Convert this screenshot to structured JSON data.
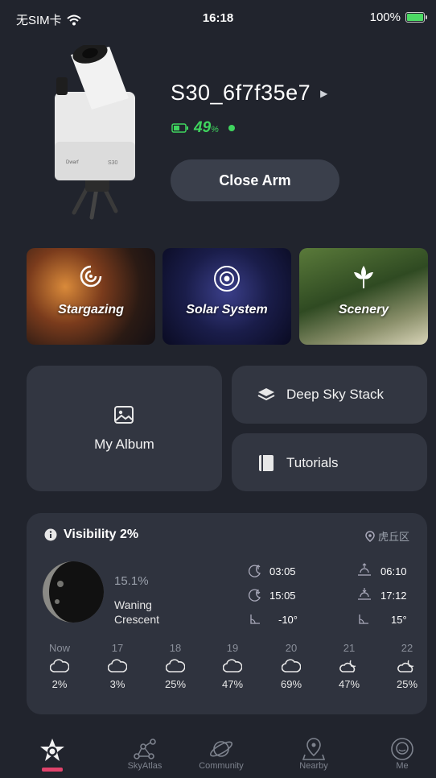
{
  "status_bar": {
    "carrier": "无SIM卡",
    "time": "16:18",
    "battery": "100%"
  },
  "device": {
    "name": "S30_6f7f35e7",
    "battery_value": "49",
    "battery_unit": "%",
    "brand": "Dwarf",
    "model": "S30",
    "connected": true
  },
  "close_arm_label": "Close Arm",
  "modes": [
    {
      "label": "Stargazing"
    },
    {
      "label": "Solar System"
    },
    {
      "label": "Scenery"
    }
  ],
  "tiles": {
    "album": "My Album",
    "stack": "Deep Sky Stack",
    "tutorials": "Tutorials"
  },
  "visibility": {
    "title": "Visibility 2%",
    "location": "虎丘区",
    "moon_percent": "15.1%",
    "moon_phase_1": "Waning",
    "moon_phase_2": "Crescent",
    "moonrise": "03:05",
    "moonset": "15:05",
    "moon_alt": "-10°",
    "sunrise": "06:10",
    "sunset": "17:12",
    "sun_alt": "15°",
    "forecast": [
      {
        "hour": "Now",
        "pct": "2%",
        "icon": "cloud-icon"
      },
      {
        "hour": "17",
        "pct": "3%",
        "icon": "cloud-icon"
      },
      {
        "hour": "18",
        "pct": "25%",
        "icon": "cloud-icon"
      },
      {
        "hour": "19",
        "pct": "47%",
        "icon": "cloud-icon"
      },
      {
        "hour": "20",
        "pct": "69%",
        "icon": "cloud-icon"
      },
      {
        "hour": "21",
        "pct": "47%",
        "icon": "cloud-moon-icon"
      },
      {
        "hour": "22",
        "pct": "25%",
        "icon": "cloud-moon-icon"
      }
    ]
  },
  "nav": [
    {
      "label": "",
      "icon": "home-star-icon",
      "active": true
    },
    {
      "label": "SkyAtlas",
      "icon": "constellation-icon"
    },
    {
      "label": "Community",
      "icon": "planet-icon"
    },
    {
      "label": "Nearby",
      "icon": "location-pin-icon"
    },
    {
      "label": "Me",
      "icon": "profile-icon"
    }
  ],
  "colors": {
    "background": "#21242d",
    "card": "#323641",
    "panel": "#2f333e",
    "accent_green": "#3fd45e",
    "nav_active": "#e0436b"
  }
}
